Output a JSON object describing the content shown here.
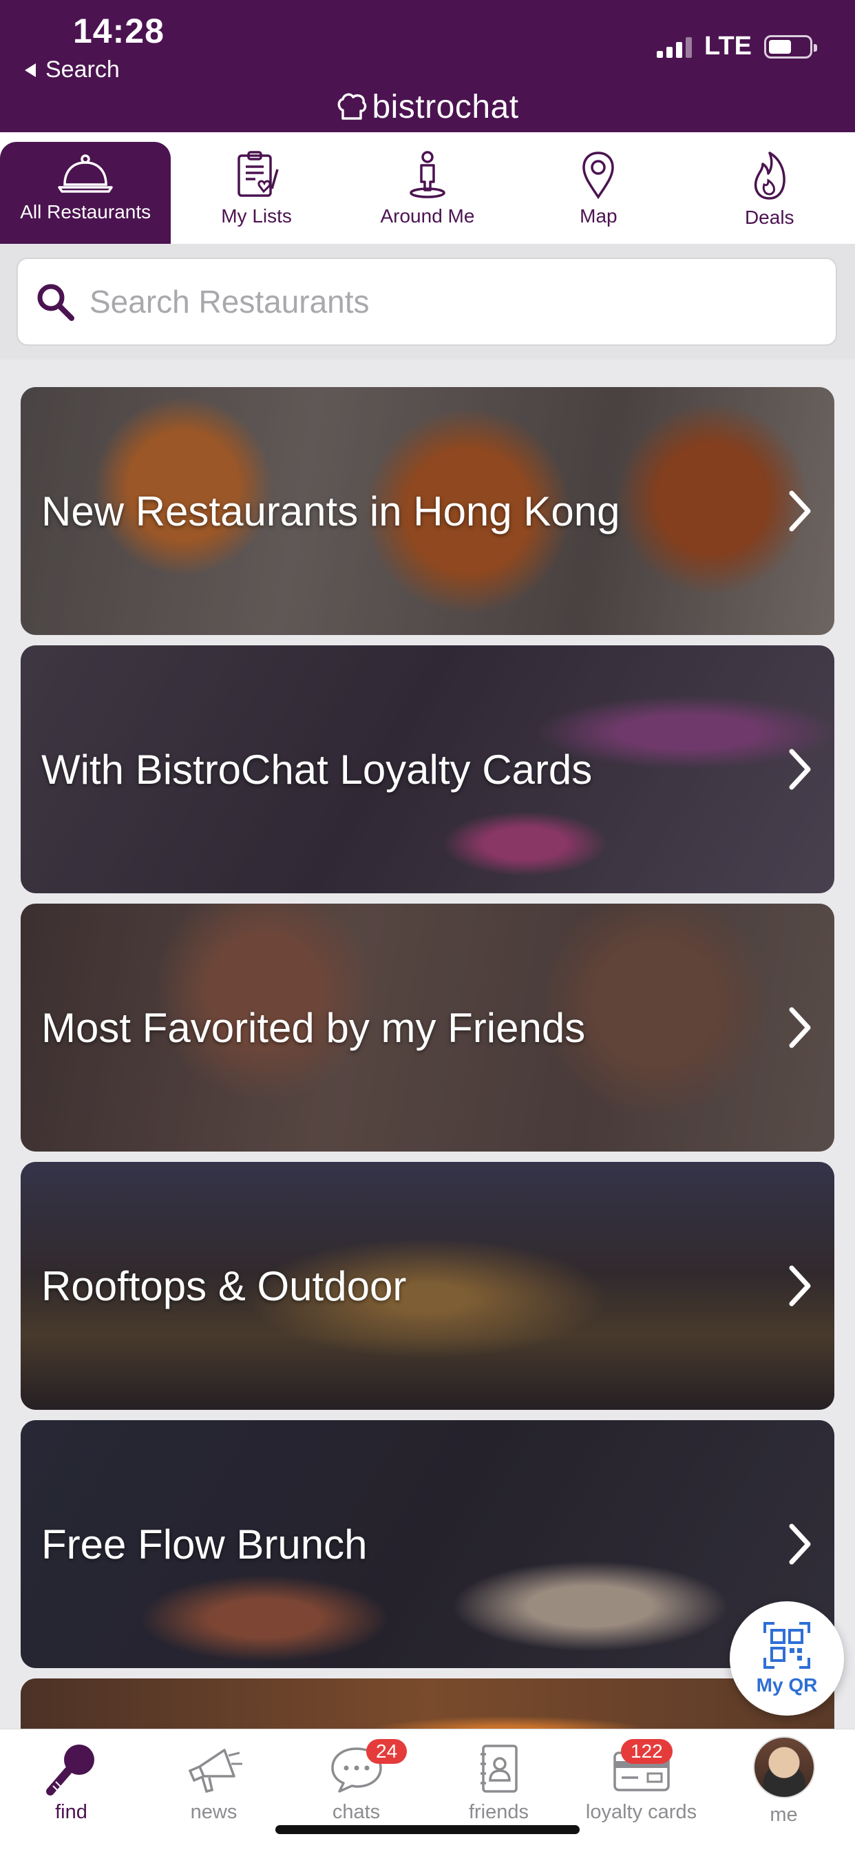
{
  "status_bar": {
    "time": "14:28",
    "back_label": "Search",
    "network": "LTE"
  },
  "app": {
    "brand": "bistrochat"
  },
  "top_tabs": [
    {
      "id": "all",
      "label": "All Restaurants",
      "icon": "cloche-icon",
      "active": true
    },
    {
      "id": "lists",
      "label": "My Lists",
      "icon": "clipboard-heart-icon",
      "active": false
    },
    {
      "id": "around",
      "label": "Around Me",
      "icon": "person-pin-icon",
      "active": false
    },
    {
      "id": "map",
      "label": "Map",
      "icon": "map-pin-icon",
      "active": false
    },
    {
      "id": "deals",
      "label": "Deals",
      "icon": "flame-icon",
      "active": false
    }
  ],
  "search": {
    "placeholder": "Search Restaurants"
  },
  "categories": [
    {
      "title": "New Restaurants in Hong Kong"
    },
    {
      "title": "With BistroChat Loyalty Cards"
    },
    {
      "title": "Most Favorited by my Friends"
    },
    {
      "title": "Rooftops & Outdoor"
    },
    {
      "title": "Free Flow Brunch"
    }
  ],
  "my_qr": {
    "label": "My QR"
  },
  "bottom_nav": [
    {
      "id": "find",
      "label": "find",
      "icon": "find-icon",
      "active": true
    },
    {
      "id": "news",
      "label": "news",
      "icon": "megaphone-icon",
      "active": false
    },
    {
      "id": "chats",
      "label": "chats",
      "icon": "chat-bubble-icon",
      "badge": "24",
      "active": false
    },
    {
      "id": "friends",
      "label": "friends",
      "icon": "contacts-book-icon",
      "active": false
    },
    {
      "id": "loyalty",
      "label": "loyalty cards",
      "icon": "card-icon",
      "badge": "122",
      "active": false
    },
    {
      "id": "me",
      "label": "me",
      "icon": "avatar",
      "active": false
    }
  ],
  "colors": {
    "brand": "#4b1350",
    "badge": "#e53b3b",
    "qr_accent": "#2f6fd6"
  }
}
